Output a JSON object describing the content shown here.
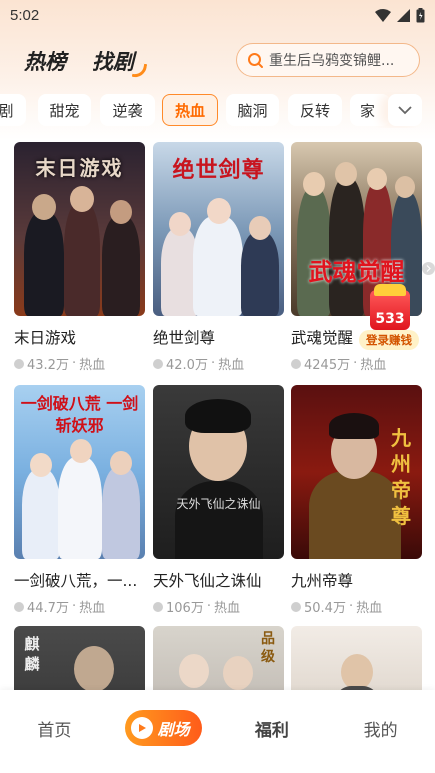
{
  "status_bar": {
    "time": "5:02"
  },
  "header": {
    "tabs": [
      "热榜",
      "找剧"
    ],
    "active_tab": "找剧"
  },
  "search": {
    "placeholder": "重生后乌鸦变锦鲤..."
  },
  "genres": {
    "items": [
      "剧",
      "甜宠",
      "逆袭",
      "热血",
      "脑洞",
      "反转",
      "家"
    ],
    "active": "热血"
  },
  "dramas": [
    {
      "title": "末日游戏",
      "plays": "43.2万",
      "tag": "热血",
      "poster_text": "末日游戏"
    },
    {
      "title": "绝世剑尊",
      "plays": "42.0万",
      "tag": "热血",
      "poster_text": "绝世剑尊"
    },
    {
      "title": "武魂觉醒",
      "plays": "4245万",
      "tag": "热血",
      "poster_text": "武魂觉醒"
    },
    {
      "title": "一剑破八荒，一...",
      "plays": "44.7万",
      "tag": "热血",
      "poster_text": "一剑破八荒 一剑斩妖邪"
    },
    {
      "title": "天外飞仙之诛仙",
      "plays": "106万",
      "tag": "热血",
      "poster_text": "天外飞仙之诛仙"
    },
    {
      "title": "九州帝尊",
      "plays": "50.4万",
      "tag": "热血",
      "poster_text": "九州帝尊"
    },
    {
      "title": "",
      "plays": "",
      "tag": "",
      "poster_text": "麒麟"
    },
    {
      "title": "",
      "plays": "",
      "tag": "",
      "poster_text": "品级"
    },
    {
      "title": "",
      "plays": "",
      "tag": "",
      "poster_text": ""
    }
  ],
  "reward": {
    "count": "533",
    "label": "登录赚钱"
  },
  "bottom_nav": {
    "items": [
      "首页",
      "剧场",
      "福利",
      "我的"
    ],
    "active": "剧场"
  },
  "colors": {
    "accent": "#ff6a00",
    "accent_light": "#fff0e3"
  }
}
